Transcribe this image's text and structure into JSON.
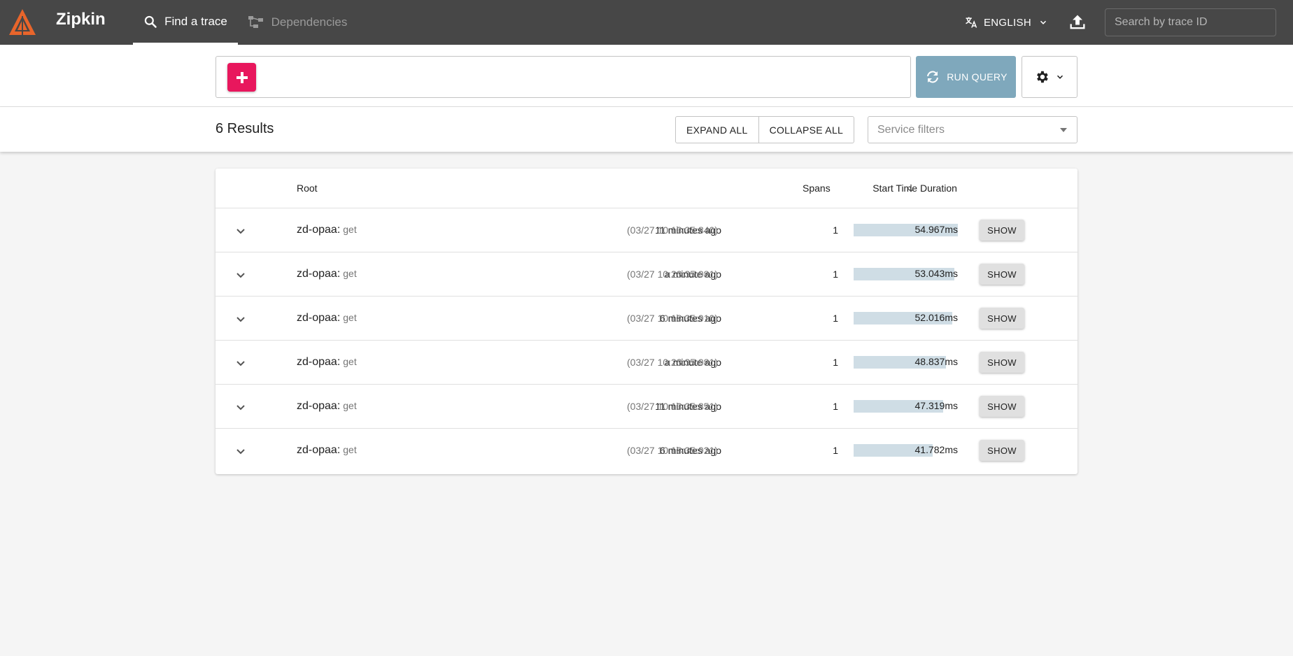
{
  "app": {
    "brand": "Zipkin"
  },
  "nav": {
    "find_trace": "Find a trace",
    "dependencies": "Dependencies"
  },
  "header": {
    "language": "ENGLISH",
    "search_placeholder": "Search by trace ID"
  },
  "query": {
    "run_label": "RUN QUERY"
  },
  "results": {
    "count_label": "6 Results",
    "expand_all": "EXPAND ALL",
    "collapse_all": "COLLAPSE ALL",
    "service_filter_placeholder": "Service filters"
  },
  "table": {
    "columns": {
      "root": "Root",
      "start_time": "Start Time",
      "spans": "Spans",
      "duration": "Duration"
    },
    "show_label": "SHOW",
    "rows": [
      {
        "service": "zd-opaa:",
        "operation": "get",
        "relative": "11 minutes ago",
        "absolute": "(03/27 10:13:35:840)",
        "spans": "1",
        "duration": "54.967ms",
        "duration_fraction": 1.0
      },
      {
        "service": "zd-opaa:",
        "operation": "get",
        "relative": "a minute ago",
        "absolute": "(03/27 10:23:35:981)",
        "spans": "1",
        "duration": "53.043ms",
        "duration_fraction": 0.965
      },
      {
        "service": "zd-opaa:",
        "operation": "get",
        "relative": "6 minutes ago",
        "absolute": "(03/27 10:18:35:910)",
        "spans": "1",
        "duration": "52.016ms",
        "duration_fraction": 0.946
      },
      {
        "service": "zd-opaa:",
        "operation": "get",
        "relative": "a minute ago",
        "absolute": "(03/27 10:23:35:981)",
        "spans": "1",
        "duration": "48.837ms",
        "duration_fraction": 0.888
      },
      {
        "service": "zd-opaa:",
        "operation": "get",
        "relative": "11 minutes ago",
        "absolute": "(03/27 10:13:35:851)",
        "spans": "1",
        "duration": "47.319ms",
        "duration_fraction": 0.861
      },
      {
        "service": "zd-opaa:",
        "operation": "get",
        "relative": "6 minutes ago",
        "absolute": "(03/27 10:18:35:921)",
        "spans": "1",
        "duration": "41.782ms",
        "duration_fraction": 0.76
      }
    ]
  },
  "colors": {
    "topbar": "#474747",
    "accent_pink": "#e8175d",
    "run_button": "#7fa8bc",
    "duration_bar": "#cfdde5",
    "logo_orange": "#e8652b"
  },
  "icons": {
    "logo": "zipkin-logo-icon",
    "find": "search-icon",
    "dependencies": "dependencies-icon",
    "language": "translate-icon",
    "upload": "upload-icon",
    "add": "plus-icon",
    "run": "refresh-icon",
    "settings": "gear-icon",
    "sort": "arrow-down-icon",
    "expand": "chevron-down-icon"
  }
}
